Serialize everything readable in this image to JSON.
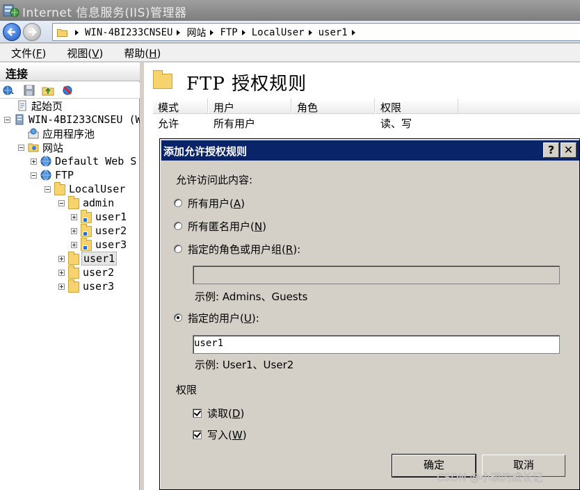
{
  "window": {
    "title": "Internet 信息服务(IIS)管理器"
  },
  "address_bar": {
    "crumbs": [
      "WIN-4BI233CNSEU",
      "网站",
      "FTP",
      "LocalUser",
      "user1"
    ]
  },
  "menu": [
    {
      "label": "文件",
      "accel": "F"
    },
    {
      "label": "视图",
      "accel": "V"
    },
    {
      "label": "帮助",
      "accel": "H"
    }
  ],
  "connections": {
    "header": "连接",
    "tree": [
      {
        "label": "起始页",
        "level": 0
      },
      {
        "label": "WIN-4BI233CNSEU (W",
        "level": 0
      },
      {
        "label": "应用程序池",
        "level": 1
      },
      {
        "label": "网站",
        "level": 1
      },
      {
        "label": "Default Web S",
        "level": 2
      },
      {
        "label": "FTP",
        "level": 2
      },
      {
        "label": "LocalUser",
        "level": 3
      },
      {
        "label": "admin",
        "level": 4
      },
      {
        "label": "user1",
        "level": 5
      },
      {
        "label": "user2",
        "level": 5
      },
      {
        "label": "user3",
        "level": 5
      },
      {
        "label": "user1",
        "level": 4,
        "selected": true
      },
      {
        "label": "user2",
        "level": 4
      },
      {
        "label": "user3",
        "level": 4
      }
    ]
  },
  "page": {
    "title": "FTP 授权规则",
    "columns": [
      "模式",
      "用户",
      "角色",
      "权限"
    ],
    "rows": [
      {
        "mode": "允许",
        "user": "所有用户",
        "role": "",
        "permission": "读、写"
      }
    ]
  },
  "dialog": {
    "title": "添加允许授权规则",
    "help": "?",
    "close": "✕",
    "prompt": "允许访问此内容:",
    "options": {
      "all_users": {
        "label": "所有用户",
        "accel": "A",
        "selected": false
      },
      "anonymous": {
        "label": "所有匿名用户",
        "accel": "N",
        "selected": false
      },
      "roles": {
        "label": "指定的角色或用户组",
        "accel": "R",
        "selected": false
      },
      "users": {
        "label": "指定的用户",
        "accel": "U",
        "selected": true
      }
    },
    "roles_value": "",
    "roles_example": "示例: Admins、Guests",
    "users_value": "user1",
    "users_example": "示例: User1、User2",
    "permissions_label": "权限",
    "read": {
      "label": "读取",
      "accel": "D",
      "checked": true
    },
    "write": {
      "label": "写入",
      "accel": "W",
      "checked": true
    },
    "ok_label": "确定",
    "cancel_label": "取消"
  },
  "watermark": "CSDN @小琪的成长记"
}
